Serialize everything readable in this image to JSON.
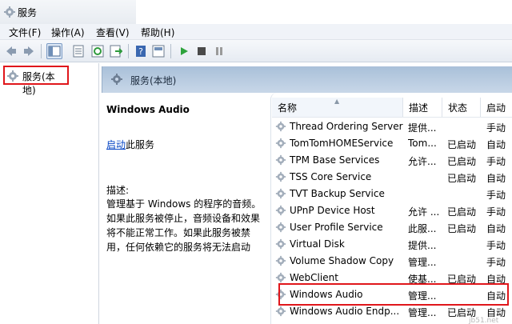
{
  "window": {
    "title": "服务"
  },
  "menu": [
    "文件(F)",
    "操作(A)",
    "查看(V)",
    "帮助(H)"
  ],
  "toolbar": {
    "icons": [
      "back-icon",
      "forward-icon",
      "show-tree-icon",
      "properties-icon",
      "refresh-icon",
      "export-icon",
      "help-icon",
      "console-icon",
      "start-icon",
      "stop-icon",
      "pause-icon"
    ]
  },
  "tree": {
    "root_label": "服务(本地)"
  },
  "pane_header": {
    "label": "服务(本地)"
  },
  "detail": {
    "title": "Windows Audio",
    "link_text": "启动",
    "link_suffix": "此服务",
    "desc_label": "描述:",
    "desc_text": "管理基于 Windows 的程序的音频。如果此服务被停止，音频设备和效果将不能正常工作。如果此服务被禁用，任何依赖它的服务将无法启动"
  },
  "columns": {
    "name": "名称",
    "desc": "描述",
    "status": "状态",
    "startup": "启动"
  },
  "services": [
    {
      "name": "Thread Ordering Server",
      "desc": "提供...",
      "status": "",
      "startup": "手动"
    },
    {
      "name": "TomTomHOMEService",
      "desc": "Tom...",
      "status": "已启动",
      "startup": "自动"
    },
    {
      "name": "TPM Base Services",
      "desc": "允许...",
      "status": "已启动",
      "startup": "手动"
    },
    {
      "name": "TSS Core Service",
      "desc": "",
      "status": "已启动",
      "startup": "自动"
    },
    {
      "name": "TVT Backup Service",
      "desc": "",
      "status": "",
      "startup": "手动"
    },
    {
      "name": "UPnP Device Host",
      "desc": "允许 ...",
      "status": "已启动",
      "startup": "手动"
    },
    {
      "name": "User Profile Service",
      "desc": "此服...",
      "status": "已启动",
      "startup": "自动"
    },
    {
      "name": "Virtual Disk",
      "desc": "提供...",
      "status": "",
      "startup": "手动"
    },
    {
      "name": "Volume Shadow Copy",
      "desc": "管理...",
      "status": "",
      "startup": "手动"
    },
    {
      "name": "WebClient",
      "desc": "使基...",
      "status": "已启动",
      "startup": "自动"
    },
    {
      "name": "Windows Audio",
      "desc": "管理...",
      "status": "",
      "startup": "自动"
    },
    {
      "name": "Windows Audio Endp...",
      "desc": "管理...",
      "status": "已启动",
      "startup": "自动"
    }
  ],
  "watermark": "jb51.net",
  "colors": {
    "highlight": "#e0161b",
    "header_gradient_top": "#a9c0d9",
    "link": "#0645c4"
  }
}
